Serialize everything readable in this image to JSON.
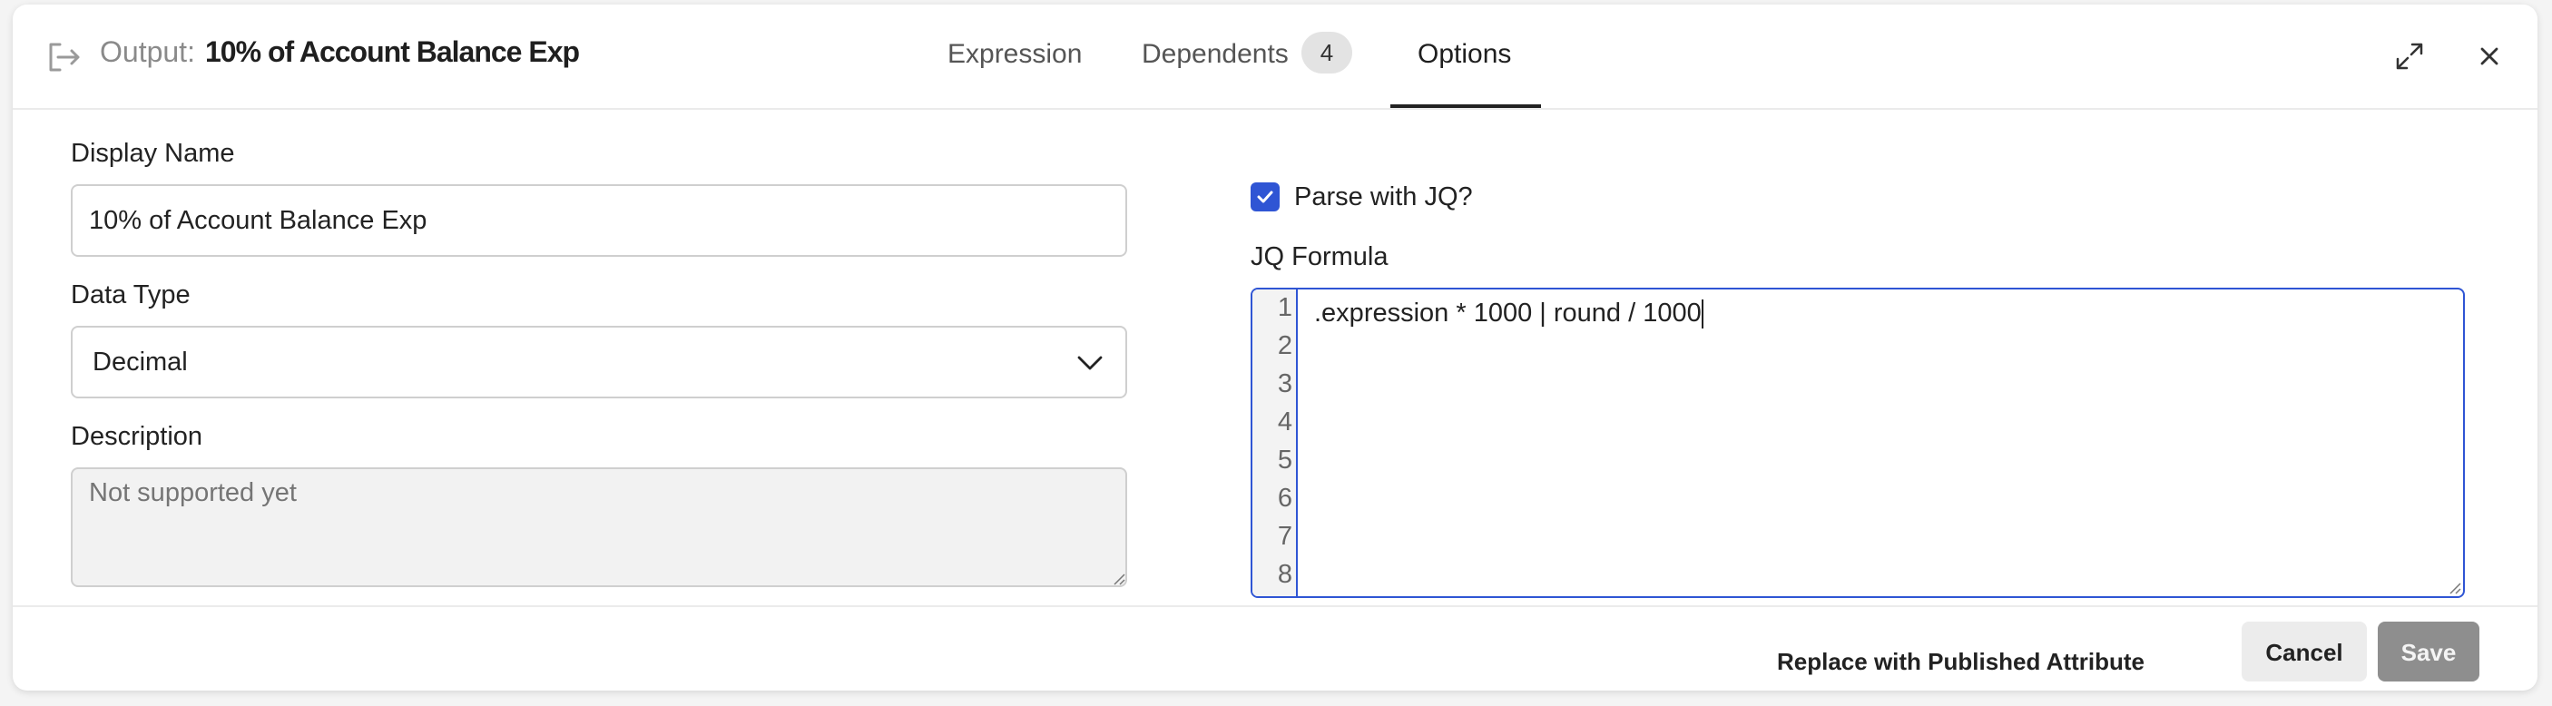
{
  "header": {
    "label": "Output:",
    "name": "10% of Account Balance Exp",
    "tabs": {
      "expression": "Expression",
      "dependents": "Dependents",
      "dependents_count": "4",
      "options": "Options"
    },
    "active_tab": "Options"
  },
  "form": {
    "display_name_label": "Display Name",
    "display_name_value": "10% of Account Balance Exp",
    "data_type_label": "Data Type",
    "data_type_value": "Decimal",
    "description_label": "Description",
    "description_placeholder": "Not supported yet",
    "parse_jq_label": "Parse with JQ?",
    "parse_jq_checked": true,
    "jq_formula_label": "JQ Formula",
    "jq_formula_line": ".expression * 1000 | round / 1000",
    "line_numbers": [
      "1",
      "2",
      "3",
      "4",
      "5",
      "6",
      "7",
      "8"
    ]
  },
  "footer": {
    "replace_label": "Replace with Published Attribute",
    "cancel_label": "Cancel",
    "save_label": "Save"
  },
  "colors": {
    "accent": "#2f55d4",
    "save_disabled": "#8e8e8e"
  },
  "icons": [
    "exit-icon",
    "expand-icon",
    "close-icon",
    "chevron-down-icon",
    "checkmark-icon"
  ]
}
